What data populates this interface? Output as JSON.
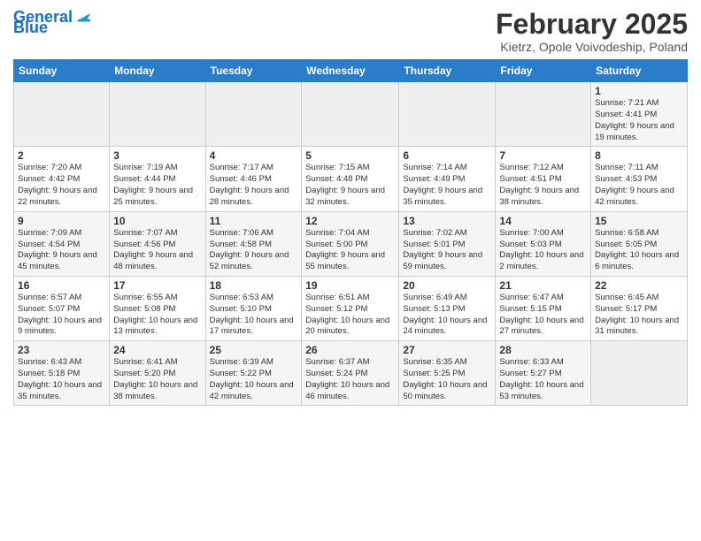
{
  "header": {
    "logo_line1": "General",
    "logo_line2": "Blue",
    "month": "February 2025",
    "location": "Kietrz, Opole Voivodeship, Poland"
  },
  "days_of_week": [
    "Sunday",
    "Monday",
    "Tuesday",
    "Wednesday",
    "Thursday",
    "Friday",
    "Saturday"
  ],
  "weeks": [
    {
      "days": [
        {
          "num": "",
          "info": ""
        },
        {
          "num": "",
          "info": ""
        },
        {
          "num": "",
          "info": ""
        },
        {
          "num": "",
          "info": ""
        },
        {
          "num": "",
          "info": ""
        },
        {
          "num": "",
          "info": ""
        },
        {
          "num": "1",
          "info": "Sunrise: 7:21 AM\nSunset: 4:41 PM\nDaylight: 9 hours and 19 minutes."
        }
      ]
    },
    {
      "days": [
        {
          "num": "2",
          "info": "Sunrise: 7:20 AM\nSunset: 4:42 PM\nDaylight: 9 hours and 22 minutes."
        },
        {
          "num": "3",
          "info": "Sunrise: 7:19 AM\nSunset: 4:44 PM\nDaylight: 9 hours and 25 minutes."
        },
        {
          "num": "4",
          "info": "Sunrise: 7:17 AM\nSunset: 4:46 PM\nDaylight: 9 hours and 28 minutes."
        },
        {
          "num": "5",
          "info": "Sunrise: 7:15 AM\nSunset: 4:48 PM\nDaylight: 9 hours and 32 minutes."
        },
        {
          "num": "6",
          "info": "Sunrise: 7:14 AM\nSunset: 4:49 PM\nDaylight: 9 hours and 35 minutes."
        },
        {
          "num": "7",
          "info": "Sunrise: 7:12 AM\nSunset: 4:51 PM\nDaylight: 9 hours and 38 minutes."
        },
        {
          "num": "8",
          "info": "Sunrise: 7:11 AM\nSunset: 4:53 PM\nDaylight: 9 hours and 42 minutes."
        }
      ]
    },
    {
      "days": [
        {
          "num": "9",
          "info": "Sunrise: 7:09 AM\nSunset: 4:54 PM\nDaylight: 9 hours and 45 minutes."
        },
        {
          "num": "10",
          "info": "Sunrise: 7:07 AM\nSunset: 4:56 PM\nDaylight: 9 hours and 48 minutes."
        },
        {
          "num": "11",
          "info": "Sunrise: 7:06 AM\nSunset: 4:58 PM\nDaylight: 9 hours and 52 minutes."
        },
        {
          "num": "12",
          "info": "Sunrise: 7:04 AM\nSunset: 5:00 PM\nDaylight: 9 hours and 55 minutes."
        },
        {
          "num": "13",
          "info": "Sunrise: 7:02 AM\nSunset: 5:01 PM\nDaylight: 9 hours and 59 minutes."
        },
        {
          "num": "14",
          "info": "Sunrise: 7:00 AM\nSunset: 5:03 PM\nDaylight: 10 hours and 2 minutes."
        },
        {
          "num": "15",
          "info": "Sunrise: 6:58 AM\nSunset: 5:05 PM\nDaylight: 10 hours and 6 minutes."
        }
      ]
    },
    {
      "days": [
        {
          "num": "16",
          "info": "Sunrise: 6:57 AM\nSunset: 5:07 PM\nDaylight: 10 hours and 9 minutes."
        },
        {
          "num": "17",
          "info": "Sunrise: 6:55 AM\nSunset: 5:08 PM\nDaylight: 10 hours and 13 minutes."
        },
        {
          "num": "18",
          "info": "Sunrise: 6:53 AM\nSunset: 5:10 PM\nDaylight: 10 hours and 17 minutes."
        },
        {
          "num": "19",
          "info": "Sunrise: 6:51 AM\nSunset: 5:12 PM\nDaylight: 10 hours and 20 minutes."
        },
        {
          "num": "20",
          "info": "Sunrise: 6:49 AM\nSunset: 5:13 PM\nDaylight: 10 hours and 24 minutes."
        },
        {
          "num": "21",
          "info": "Sunrise: 6:47 AM\nSunset: 5:15 PM\nDaylight: 10 hours and 27 minutes."
        },
        {
          "num": "22",
          "info": "Sunrise: 6:45 AM\nSunset: 5:17 PM\nDaylight: 10 hours and 31 minutes."
        }
      ]
    },
    {
      "days": [
        {
          "num": "23",
          "info": "Sunrise: 6:43 AM\nSunset: 5:18 PM\nDaylight: 10 hours and 35 minutes."
        },
        {
          "num": "24",
          "info": "Sunrise: 6:41 AM\nSunset: 5:20 PM\nDaylight: 10 hours and 38 minutes."
        },
        {
          "num": "25",
          "info": "Sunrise: 6:39 AM\nSunset: 5:22 PM\nDaylight: 10 hours and 42 minutes."
        },
        {
          "num": "26",
          "info": "Sunrise: 6:37 AM\nSunset: 5:24 PM\nDaylight: 10 hours and 46 minutes."
        },
        {
          "num": "27",
          "info": "Sunrise: 6:35 AM\nSunset: 5:25 PM\nDaylight: 10 hours and 50 minutes."
        },
        {
          "num": "28",
          "info": "Sunrise: 6:33 AM\nSunset: 5:27 PM\nDaylight: 10 hours and 53 minutes."
        },
        {
          "num": "",
          "info": ""
        }
      ]
    }
  ]
}
